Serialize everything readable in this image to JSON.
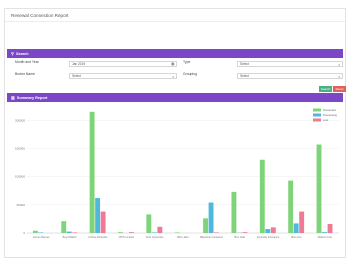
{
  "page": {
    "title": "Renewal Connection Report"
  },
  "search": {
    "title": "Search",
    "month_year": {
      "label": "Month and Year",
      "value": "Jan 2019"
    },
    "type": {
      "label": "Type",
      "value": "Select"
    },
    "broker_name": {
      "label": "Broker Name",
      "value": "Select"
    },
    "grouping": {
      "label": "Grouping",
      "value": "Select"
    },
    "search_button": "Search",
    "reset_button": "Reset",
    "calendar_icon": "calendar-icon"
  },
  "summary": {
    "title": "Summary Report"
  },
  "colors": {
    "header": "#7b47c6",
    "green": "#7fd47a",
    "blue": "#4fb9dc",
    "pink": "#ee7b96"
  },
  "chart_data": {
    "type": "bar",
    "y_ticks": [
      "0",
      "50000",
      "100000",
      "150000",
      "200000"
    ],
    "ylim": [
      0,
      220000
    ],
    "categories": [
      "James Barnes",
      "Boyd Walsh",
      "Forbes Richards",
      "CIPS Limited",
      "First Corporate",
      "Blue Jaint",
      "Milestone Insurance",
      "Bon Vale",
      "Kennedy Insurance",
      "Boo Line",
      "Watson Link"
    ],
    "series": [
      {
        "name": "Presented",
        "color": "#7fd47a",
        "values": [
          4000,
          21000,
          215000,
          1500,
          33000,
          1000,
          26000,
          73000,
          130000,
          93000,
          157000
        ]
      },
      {
        "name": "Processing",
        "color": "#4fb9dc",
        "values": [
          1000,
          2500,
          62000,
          0,
          1000,
          0,
          54000,
          500,
          7000,
          17000,
          1500
        ]
      },
      {
        "name": "Lost",
        "color": "#ee7b96",
        "values": [
          0,
          1000,
          38000,
          1500,
          11000,
          0,
          1000,
          1500,
          10000,
          38000,
          16000
        ]
      }
    ],
    "grid": true,
    "legend_position": "top-right"
  }
}
